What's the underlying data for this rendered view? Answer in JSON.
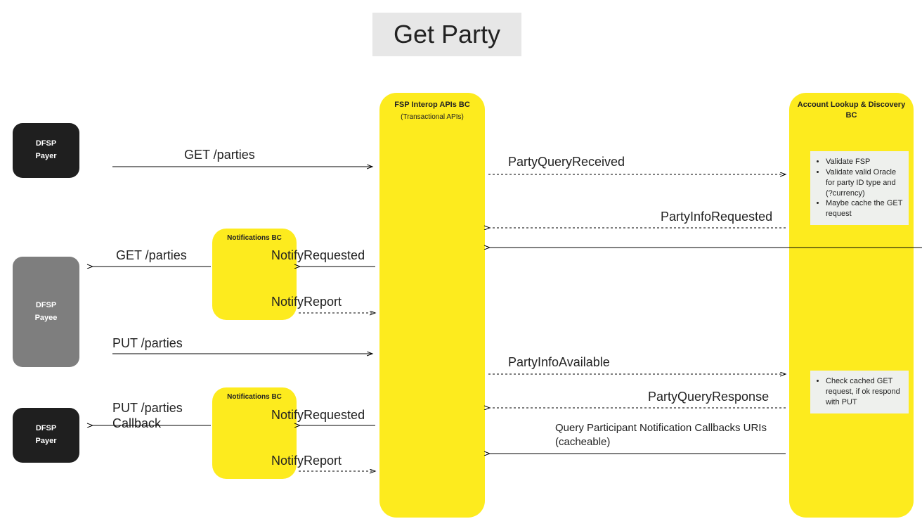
{
  "title": "Get Party",
  "actors": {
    "payer_top": {
      "l1": "DFSP",
      "l2": "Payer"
    },
    "payee": {
      "l1": "DFSP",
      "l2": "Payee"
    },
    "payer_bot": {
      "l1": "DFSP",
      "l2": "Payer"
    }
  },
  "columns": {
    "fsp_interop": {
      "title": "FSP Interop APIs BC",
      "subtitle": "(Transactional APIs)"
    },
    "account_lookup": {
      "title": "Account Lookup & Discovery BC"
    }
  },
  "notif_box_1": "Notifications BC",
  "notif_box_2": "Notifications BC",
  "notes": {
    "validate": [
      "Validate FSP",
      "Validate valid Oracle for party ID type and (?currency)",
      "Maybe cache the GET request"
    ],
    "cache": [
      "Check cached GET request, if ok respond with PUT"
    ]
  },
  "messages": {
    "get_parties_top": "GET /parties",
    "party_query_received": "PartyQueryReceived",
    "party_info_requested": "PartyInfoRequested",
    "get_parties_mid": "GET /parties",
    "notify_requested_1": "NotifyRequested",
    "notify_report_1": "NotifyReport",
    "put_parties": "PUT /parties",
    "party_info_available": "PartyInfoAvailable",
    "party_query_response": "PartyQueryResponse",
    "put_parties_cb_l1": "PUT /parties",
    "put_parties_cb_l2": "Callback",
    "notify_requested_2": "NotifyRequested",
    "notify_report_2": "NotifyReport",
    "query_cb_l1": "Query Participant Notification Callbacks URIs",
    "query_cb_l2": "(cacheable)"
  }
}
